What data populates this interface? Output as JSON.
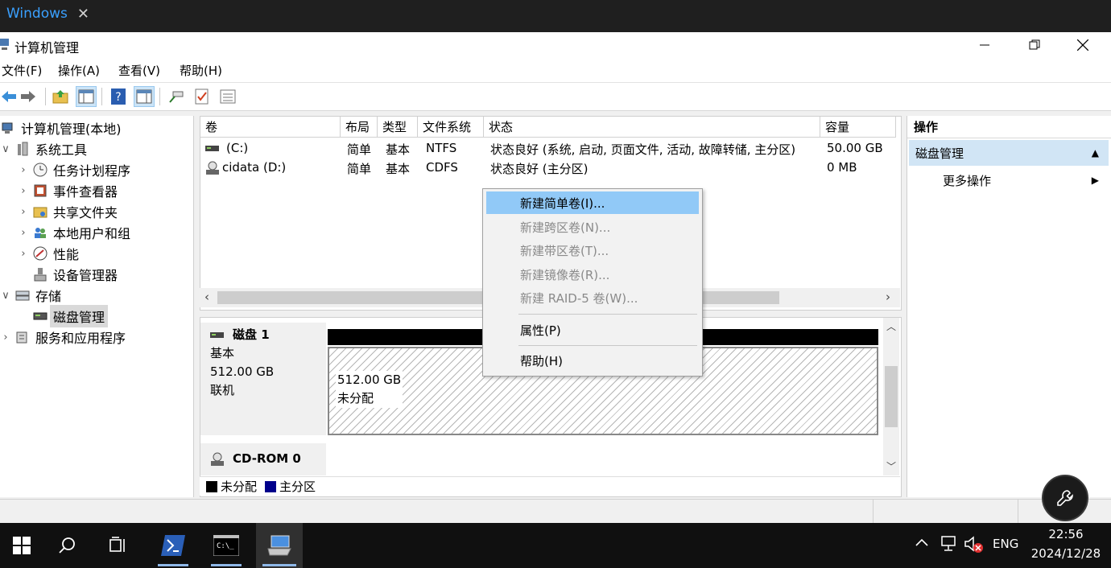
{
  "tab": {
    "label": "Windows"
  },
  "window": {
    "title": "计算机管理"
  },
  "menu": [
    "文件(F)",
    "操作(A)",
    "查看(V)",
    "帮助(H)"
  ],
  "tree": [
    {
      "label": "计算机管理(本地)",
      "chev": ""
    },
    {
      "label": "系统工具",
      "chev": "∨"
    },
    {
      "label": "任务计划程序",
      "chev": "›"
    },
    {
      "label": "事件查看器",
      "chev": "›"
    },
    {
      "label": "共享文件夹",
      "chev": "›"
    },
    {
      "label": "本地用户和组",
      "chev": "›"
    },
    {
      "label": "性能",
      "chev": "›"
    },
    {
      "label": "设备管理器",
      "chev": ""
    },
    {
      "label": "存储",
      "chev": "∨"
    },
    {
      "label": "磁盘管理",
      "chev": ""
    },
    {
      "label": "服务和应用程序",
      "chev": "›"
    }
  ],
  "volumes": {
    "columns": [
      "卷",
      "布局",
      "类型",
      "文件系统",
      "状态",
      "容量"
    ],
    "rows": [
      {
        "name": "(C:)",
        "layout": "简单",
        "type": "基本",
        "fs": "NTFS",
        "status": "状态良好 (系统, 启动, 页面文件, 活动, 故障转储, 主分区)",
        "capacity": "50.00 GB"
      },
      {
        "name": "cidata (D:)",
        "layout": "简单",
        "type": "基本",
        "fs": "CDFS",
        "status": "状态良好 (主分区)",
        "capacity": "0 MB"
      }
    ]
  },
  "disks": [
    {
      "name": "磁盘 1",
      "kind": "基本",
      "size": "512.00 GB",
      "state": "联机",
      "partition_size": "512.00 GB",
      "partition_label": "未分配"
    },
    {
      "name": "CD-ROM 0"
    }
  ],
  "legend": [
    {
      "label": "未分配",
      "color": "#000000"
    },
    {
      "label": "主分区",
      "color": "#00008b"
    }
  ],
  "actions": {
    "header": "操作",
    "section": "磁盘管理",
    "more": "更多操作"
  },
  "context_menu": {
    "items": [
      {
        "label": "新建简单卷(I)...",
        "enabled": true,
        "highlight": true
      },
      {
        "label": "新建跨区卷(N)...",
        "enabled": false
      },
      {
        "label": "新建带区卷(T)...",
        "enabled": false
      },
      {
        "label": "新建镜像卷(R)...",
        "enabled": false
      },
      {
        "label": "新建 RAID-5 卷(W)...",
        "enabled": false
      },
      {
        "label": "属性(P)",
        "enabled": true
      },
      {
        "label": "帮助(H)",
        "enabled": true
      }
    ]
  },
  "taskbar": {
    "time": "22:56",
    "date": "2024/12/28",
    "lang": "ENG"
  },
  "colors": {
    "accent": "#91c9f7",
    "selected_header": "#d1e5f5"
  }
}
